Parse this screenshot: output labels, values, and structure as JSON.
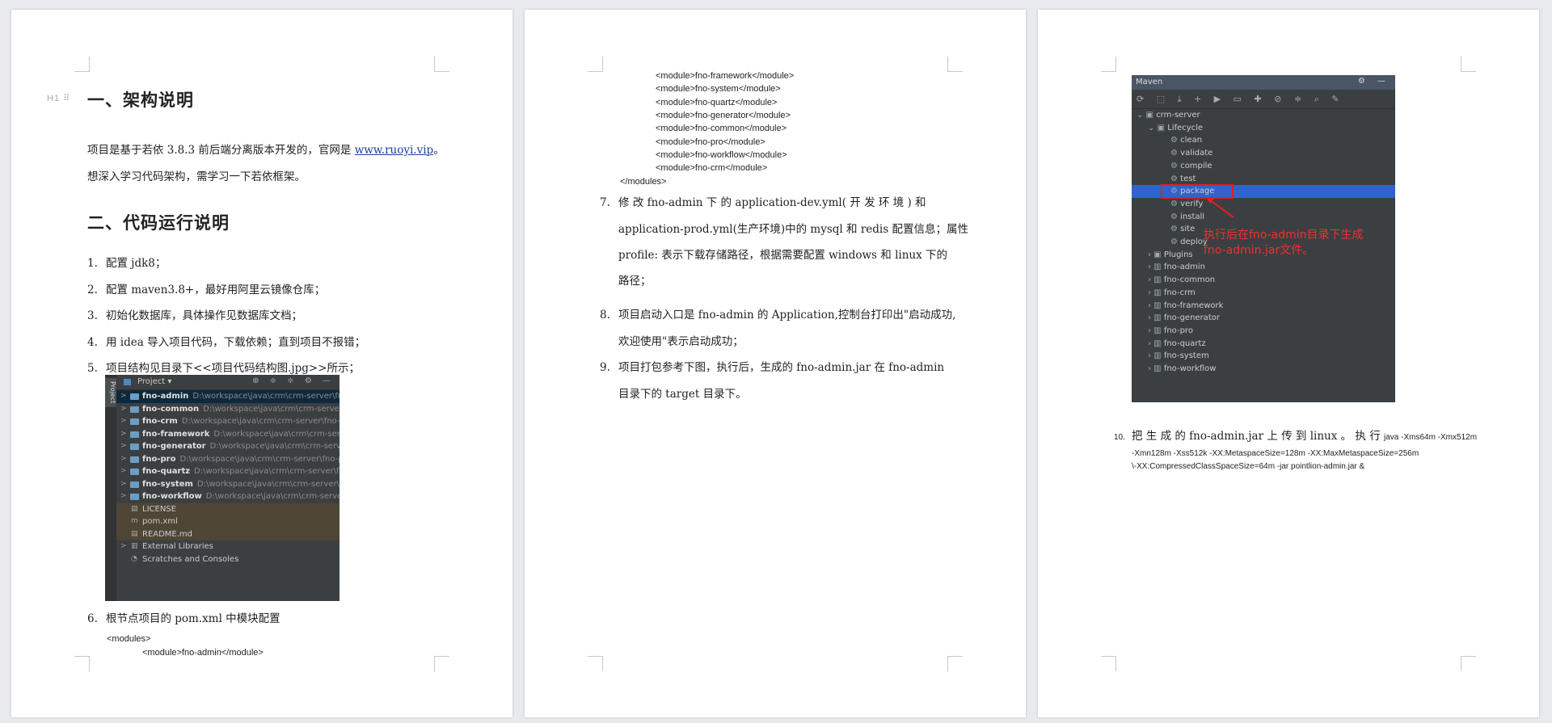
{
  "page1": {
    "heading_icon": "H1 ⠿",
    "h1": "一、架构说明",
    "intro_before_link": "项目是基于若依 3.8.3 前后端分离版本开发的，官网是 ",
    "intro_link": "www.ruoyi.vip",
    "intro_after_link": "。",
    "intro_line2": "想深入学习代码架构，需学习一下若依框架。",
    "h2": "二、代码运行说明",
    "steps": [
      {
        "num": "1.",
        "text": "配置 jdk8；"
      },
      {
        "num": "2.",
        "text": "配置 maven3.8+，最好用阿里云镜像仓库；"
      },
      {
        "num": "3.",
        "text": "初始化数据库，具体操作见数据库文档；"
      },
      {
        "num": "4.",
        "text": "用 idea  导入项目代码，下载依赖；直到项目不报错；"
      },
      {
        "num": "5.",
        "text": "项目结构见目录下<<项目代码结构图.jpg>>所示；"
      }
    ],
    "ide": {
      "side_tab": "Project",
      "title": "Project",
      "toolbar": "⊕ ≑ ≑ ⚙ —",
      "rows": [
        {
          "name": "fno-admin",
          "path": "D:\\workspace\\java\\crm\\crm-server\\fno-a"
        },
        {
          "name": "fno-common",
          "path": "D:\\workspace\\java\\crm\\crm-server\\fno"
        },
        {
          "name": "fno-crm",
          "path": "D:\\workspace\\java\\crm\\crm-server\\fno-crm"
        },
        {
          "name": "fno-framework",
          "path": "D:\\workspace\\java\\crm\\crm-server\\f"
        },
        {
          "name": "fno-generator",
          "path": "D:\\workspace\\java\\crm\\crm-server\\fn"
        },
        {
          "name": "fno-pro",
          "path": "D:\\workspace\\java\\crm\\crm-server\\fno-pro"
        },
        {
          "name": "fno-quartz",
          "path": "D:\\workspace\\java\\crm\\crm-server\\fno-q"
        },
        {
          "name": "fno-system",
          "path": "D:\\workspace\\java\\crm\\crm-server\\fno-s"
        },
        {
          "name": "fno-workflow",
          "path": "D:\\workspace\\java\\crm\\crm-server\\fn"
        }
      ],
      "files": [
        "LICENSE",
        "pom.xml",
        "README.md"
      ],
      "extra": [
        "External Libraries",
        "Scratches and Consoles"
      ]
    },
    "step6_num": "6.",
    "step6_text": "根节点项目的 pom.xml 中模块配置",
    "code_open": "<modules>",
    "code_first": "<module>fno-admin</module>"
  },
  "page2": {
    "code_lines": [
      "<module>fno-framework</module>",
      "<module>fno-system</module>",
      "<module>fno-quartz</module>",
      "<module>fno-generator</module>",
      "<module>fno-common</module>",
      "<module>fno-pro</module>",
      "<module>fno-workflow</module>",
      "<module>fno-crm</module>"
    ],
    "code_close": "</modules>",
    "step7_num": "7.",
    "step7_l1": "修 改  fno-admin  下 的  application-dev.yml( 开 发 环 境 ) 和",
    "step7_l2": "application-prod.yml(生产环境)中的 mysql 和 redis 配置信息；属性",
    "step7_l3": "profile: 表示下载存储路径，根据需要配置 windows 和 linux 下的",
    "step7_l4": "路径；",
    "step8_num": "8.",
    "step8_l1": "项目启动入口是 fno-admin 的 Application,控制台打印出\"启动成功,",
    "step8_l2": "欢迎使用\"表示启动成功；",
    "step9_num": "9.",
    "step9_l1": "项目打包参考下图，执行后，生成的 fno-admin.jar 在 fno-admin",
    "step9_l2": "目录下的 target 目录下。"
  },
  "page3": {
    "maven": {
      "title": "Maven",
      "head_tools": "⚙ —",
      "toolbar": "⟳ ⬚ ⤓ + ▶ ▭ ✚ ⊘ ≑ ⌕ ✎",
      "root": "crm-server",
      "lifecycle": "Lifecycle",
      "phases": [
        "clean",
        "validate",
        "compile",
        "test",
        "package",
        "verify",
        "install",
        "site",
        "deploy"
      ],
      "plugins": "Plugins",
      "modules": [
        "fno-admin",
        "fno-common",
        "fno-crm",
        "fno-framework",
        "fno-generator",
        "fno-pro",
        "fno-quartz",
        "fno-system",
        "fno-workflow"
      ]
    },
    "annotation_l1": "执行后在fno-admin目录下生成",
    "annotation_l2": "fno-admin.jar文件。",
    "step10_num": "10.",
    "step10_l1_main": "把 生 成 的  fno-admin.jar  上 传 到  linux 。 执 行 ",
    "step10_l1_small": "java  -Xms64m  -Xmx512m",
    "step10_l2": "-Xmn128m          -Xss512k          -XX:MetaspaceSize=128m          -XX:MaxMetaspaceSize=256m",
    "step10_l3": "\\-XX:CompressedClassSpaceSize=64m -jar pointlion-admin.jar &"
  }
}
